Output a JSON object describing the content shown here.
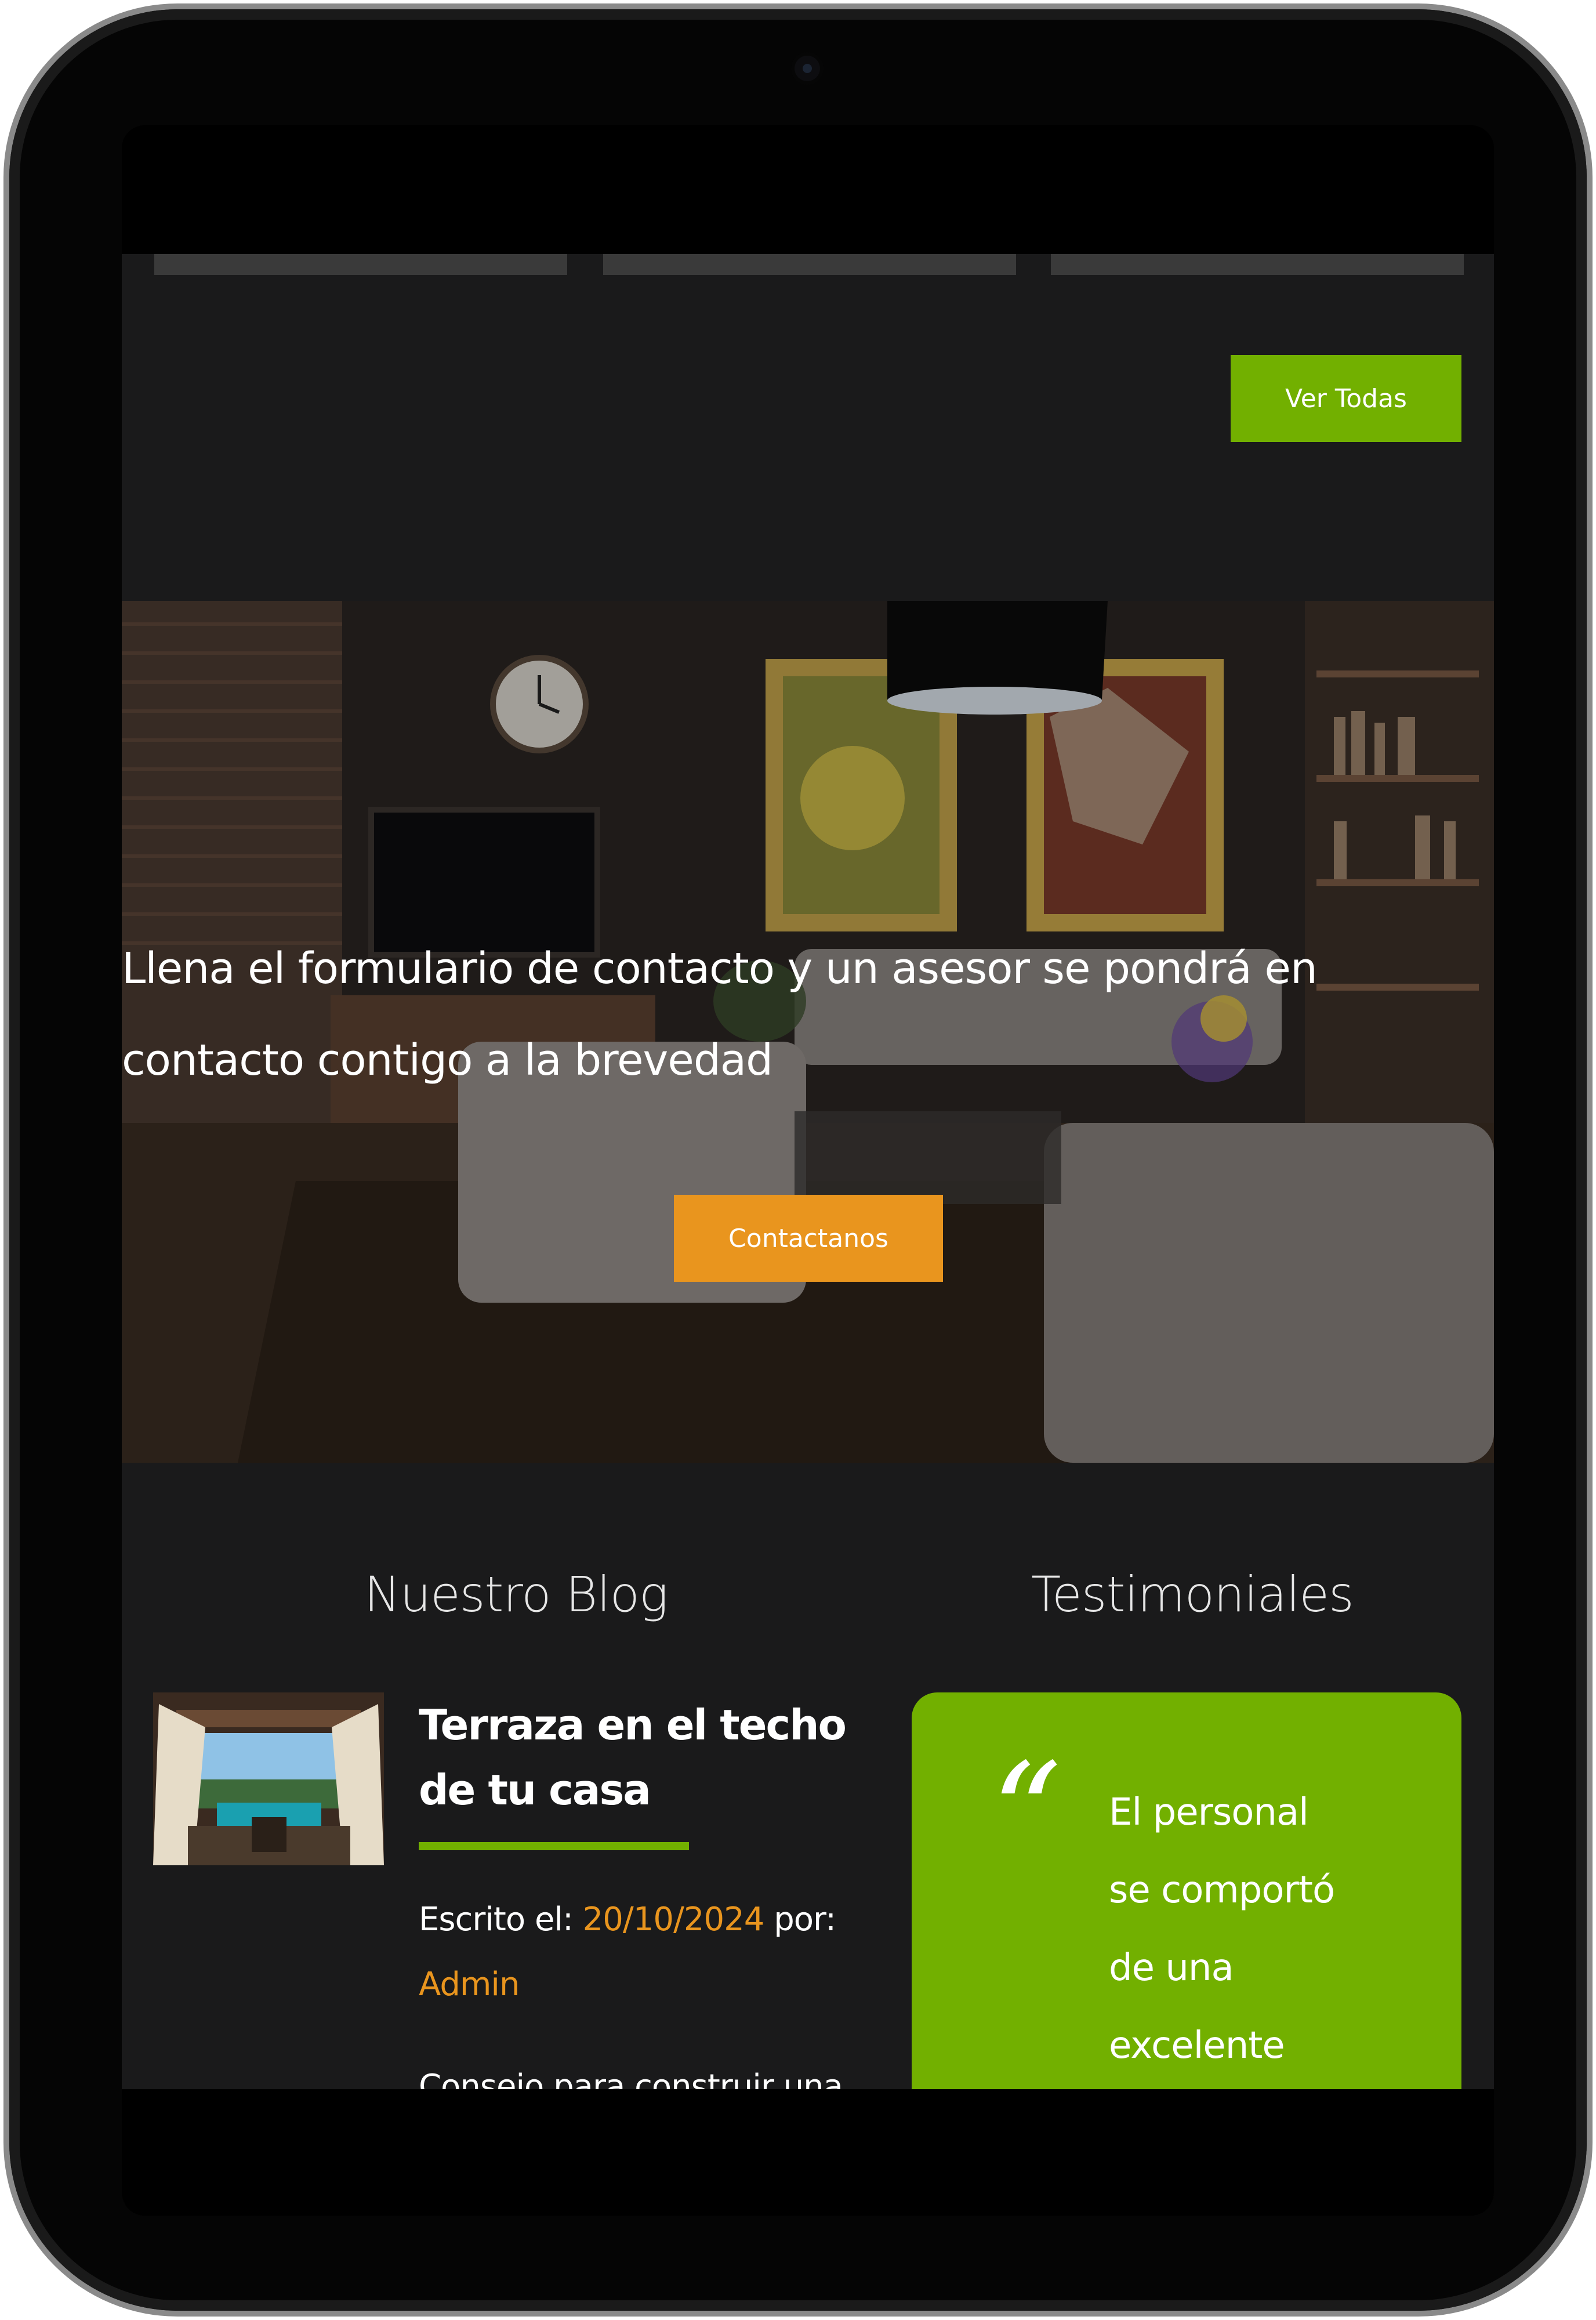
{
  "listing": {
    "view_all_label": "Ver Todas"
  },
  "hero": {
    "text": "Llena el formulario de contacto y un asesor se pondrá en contacto contigo a la brevedad",
    "button_label": "Contactanos"
  },
  "blog": {
    "section_title": "Nuestro Blog",
    "post": {
      "title": "Terraza en el techo de tu casa",
      "written_label": "Escrito el:",
      "date": "20/10/2024",
      "by_label": "por:",
      "author": "Admin",
      "excerpt": "Consejo para construir una terraza en el techo de tu casa"
    }
  },
  "testimonials": {
    "section_title": "Testimoniales",
    "quote_mark": "“",
    "text": "El personal se comportó de una excelente forma, muy buena"
  },
  "colors": {
    "accent_green": "#72b000",
    "accent_orange": "#e9951e",
    "page_background": "#1a1a1b"
  }
}
